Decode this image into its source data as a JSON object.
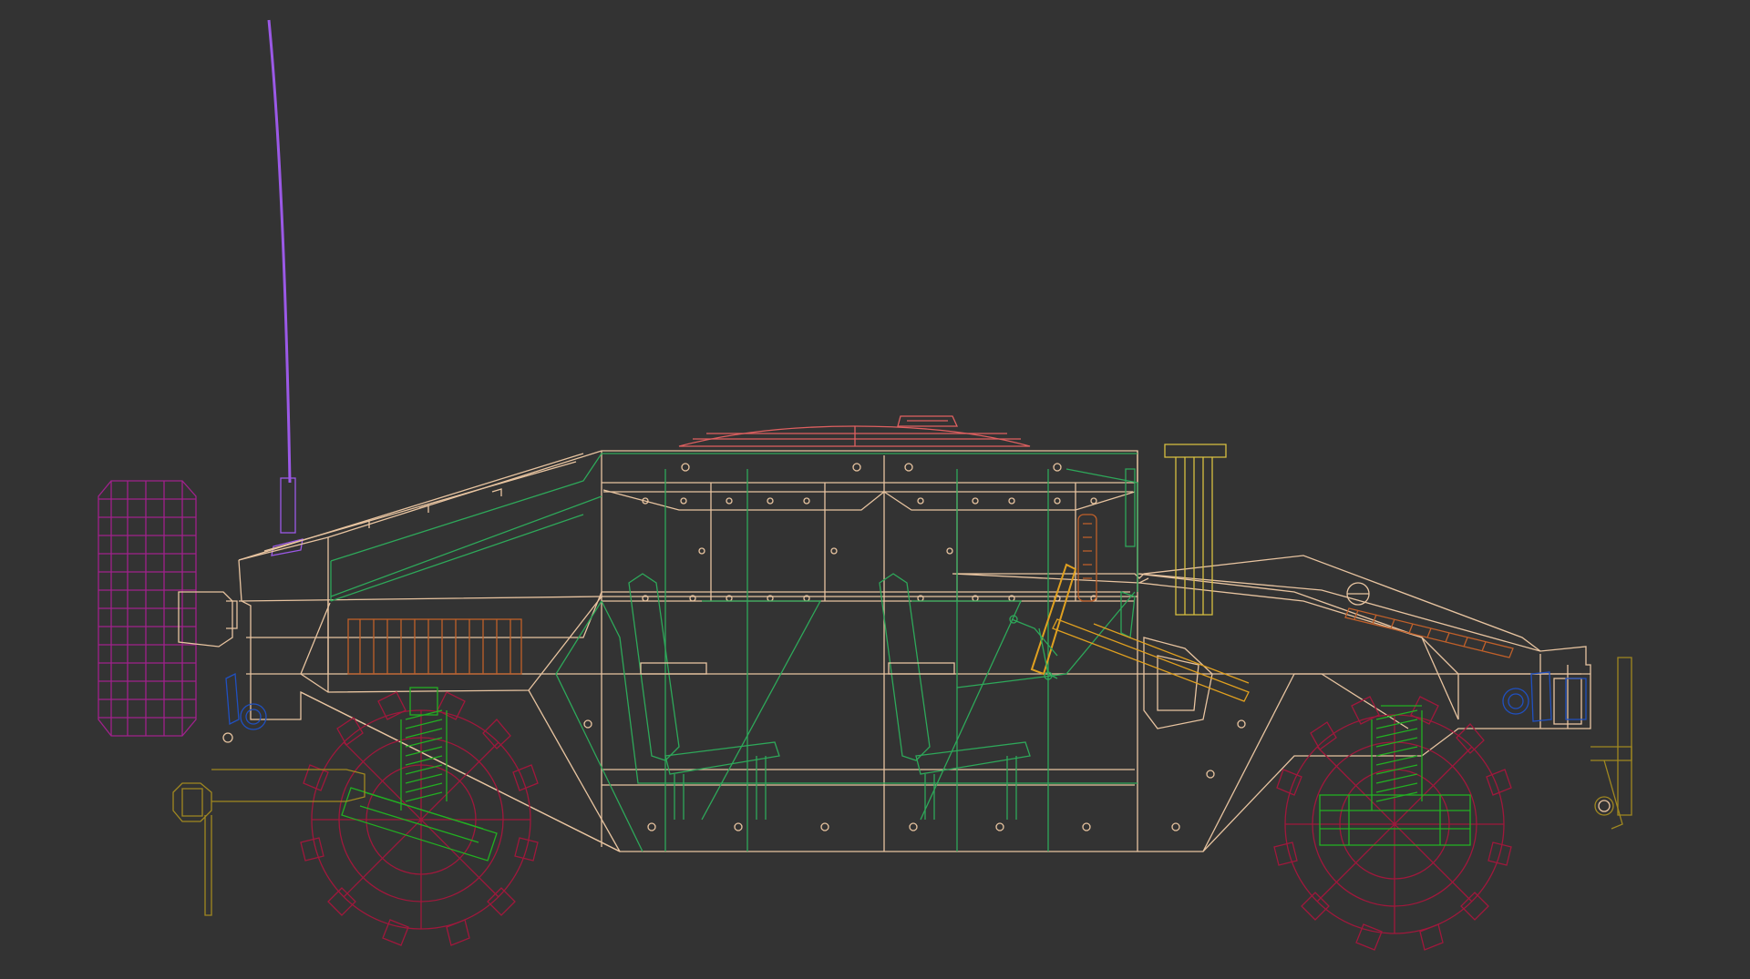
{
  "viewport": {
    "name": "wireframe-viewport",
    "background": "#333333",
    "render_mode": "wireframe"
  },
  "model": {
    "subject": "humvee-vehicle-side-view",
    "parts": [
      {
        "name": "radio-antenna",
        "color": "#9b59e6"
      },
      {
        "name": "spare-tire",
        "color": "#a0218c"
      },
      {
        "name": "hull-body",
        "color": "#e8c4a0"
      },
      {
        "name": "interior-frame",
        "color": "#2ea85a"
      },
      {
        "name": "turret-hatch",
        "color": "#e06060"
      },
      {
        "name": "exhaust-stack",
        "color": "#d8c040"
      },
      {
        "name": "front-wheel",
        "color": "#a0183c"
      },
      {
        "name": "rear-wheel",
        "color": "#a0183c"
      },
      {
        "name": "suspension-springs",
        "color": "#22b022"
      },
      {
        "name": "tow-hitch",
        "color": "#a08820"
      },
      {
        "name": "headlights",
        "color": "#2050c0"
      },
      {
        "name": "grille-vents",
        "color": "#c0602a"
      },
      {
        "name": "steering-assembly",
        "color": "#e0a020"
      }
    ]
  }
}
